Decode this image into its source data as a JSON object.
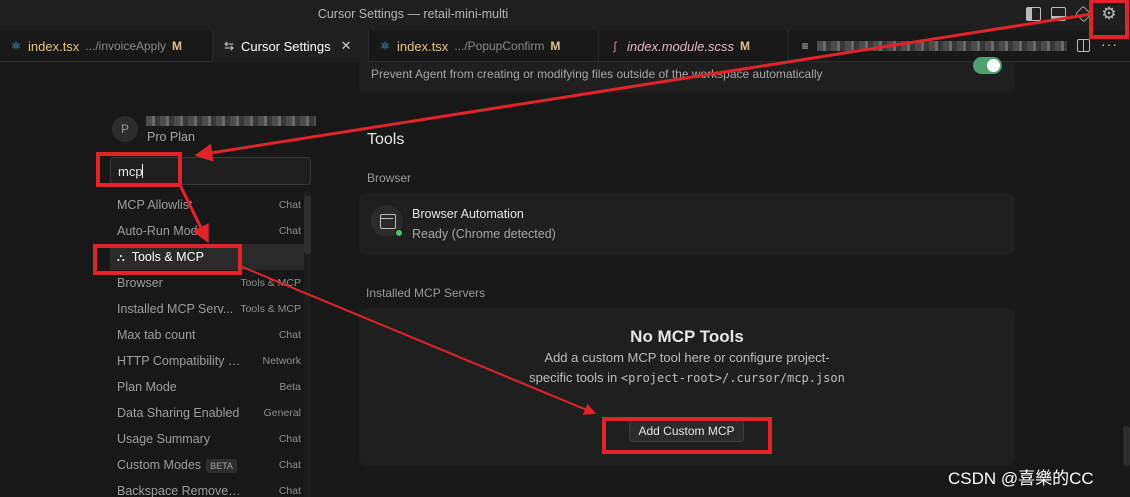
{
  "window": {
    "title": "Cursor Settings — retail-mini-multi"
  },
  "tabs": [
    {
      "icon": "react-icon",
      "name": "index.tsx",
      "path": ".../invoiceApply",
      "modified": "M",
      "active": false
    },
    {
      "icon": "settings-icon",
      "name": "Cursor Settings",
      "path": "",
      "modified": "",
      "close": "✕",
      "active": true
    },
    {
      "icon": "react-icon",
      "name": "index.tsx",
      "path": ".../PopupConfirm",
      "modified": "M",
      "active": false
    },
    {
      "icon": "sass-icon",
      "name": "index.module.scss",
      "path": "",
      "modified": "M",
      "active": false
    },
    {
      "icon": "list-icon",
      "name": "",
      "path": "",
      "modified": "",
      "active": false
    }
  ],
  "sidebar": {
    "avatar_initial": "P",
    "plan": "Pro Plan",
    "search_value": "mcp",
    "results": [
      {
        "label": "MCP Allowlist",
        "category": "Chat"
      },
      {
        "label": "Auto-Run Mode",
        "category": "Chat"
      },
      {
        "label": "Tools & MCP",
        "category": "",
        "active": true
      },
      {
        "label": "Browser",
        "category": "Tools & MCP"
      },
      {
        "label": "Installed MCP Serv...",
        "category": "Tools & MCP"
      },
      {
        "label": "Max tab count",
        "category": "Chat"
      },
      {
        "label": "HTTP Compatibility Mo...",
        "category": "Network"
      },
      {
        "label": "Plan Mode",
        "category": "Beta"
      },
      {
        "label": "Data Sharing Enabled",
        "category": "General"
      },
      {
        "label": "Usage Summary",
        "category": "Chat"
      },
      {
        "label": "Custom Modes",
        "badge": "BETA",
        "category": "Chat"
      },
      {
        "label": "Backspace Removes Cont...",
        "category": "Chat"
      }
    ]
  },
  "main": {
    "protection_text": "Prevent Agent from creating or modifying files outside of the workspace automatically",
    "protection_enabled": true,
    "tools_heading": "Tools",
    "browser_heading": "Browser",
    "browser_title": "Browser Automation",
    "browser_status": "Ready (Chrome detected)",
    "installed_heading": "Installed MCP Servers",
    "empty_title": "No MCP Tools",
    "empty_desc_1": "Add a custom MCP tool here or configure project-specific tools in ",
    "empty_desc_code": "<project-root>/.cursor/mcp.json",
    "add_button": "Add Custom MCP"
  },
  "watermark": "CSDN @喜樂的CC",
  "colors": {
    "annotation_red": "#e0242a",
    "toggle_green": "#4fa06a",
    "status_green": "#4fbf6d"
  }
}
